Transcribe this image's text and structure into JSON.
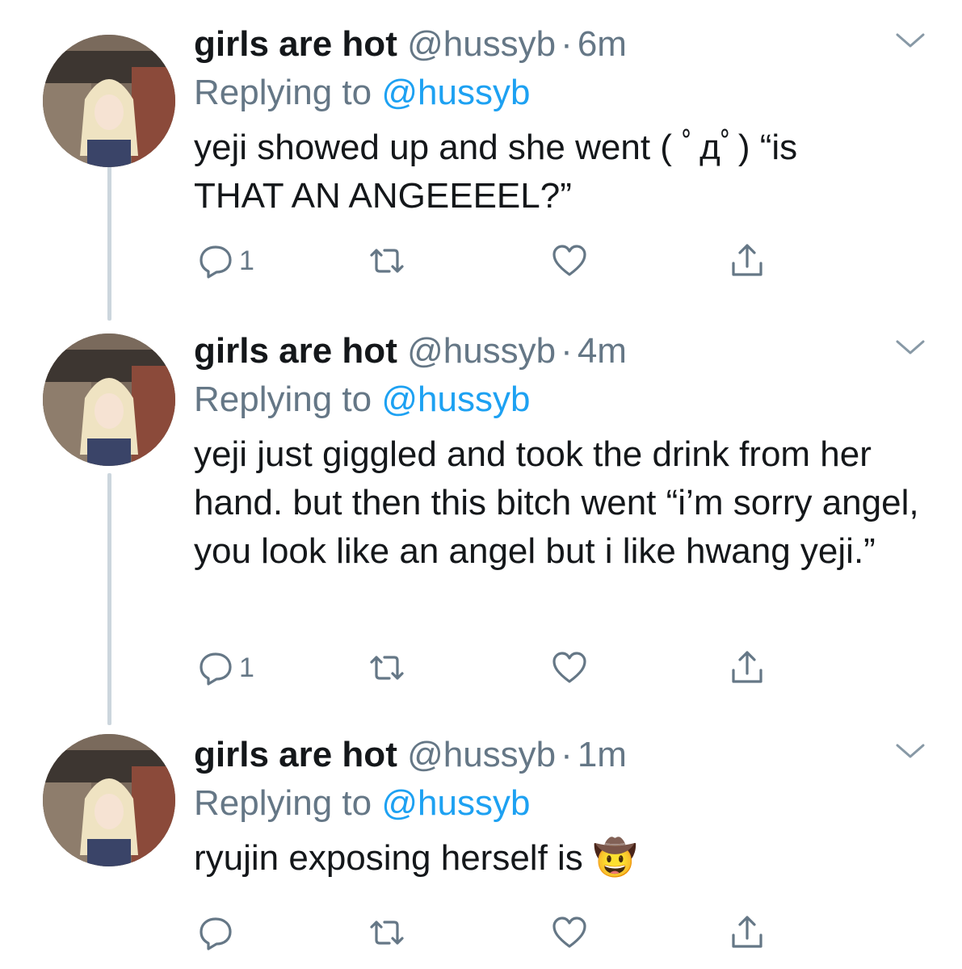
{
  "tweets": [
    {
      "display_name": "girls are hot",
      "handle": "@hussyb",
      "separator": "·",
      "time": "6m",
      "replying_prefix": "Replying to",
      "replying_to": "@hussyb",
      "text": "yeji showed up and she went ( ﾟдﾟ) “is THAT AN ANGEEEEL?”",
      "reply_count": "1"
    },
    {
      "display_name": "girls are hot",
      "handle": "@hussyb",
      "separator": "·",
      "time": "4m",
      "replying_prefix": "Replying to",
      "replying_to": "@hussyb",
      "text": "yeji just giggled and took the drink from her hand. but then this bitch went “i’m sorry angel, you look like an angel but i like hwang yeji.”",
      "reply_count": "1"
    },
    {
      "display_name": "girls are hot",
      "handle": "@hussyb",
      "separator": "·",
      "time": "1m",
      "replying_prefix": "Replying to",
      "replying_to": "@hussyb",
      "text": "ryujin exposing herself is 🤠",
      "reply_count": ""
    }
  ],
  "colors": {
    "primary_text": "#14171a",
    "secondary_text": "#657786",
    "link": "#1da1f2",
    "thread_line": "#ccd6dd"
  },
  "icons": [
    "reply-icon",
    "retweet-icon",
    "like-icon",
    "share-icon",
    "chevron-down-icon"
  ]
}
